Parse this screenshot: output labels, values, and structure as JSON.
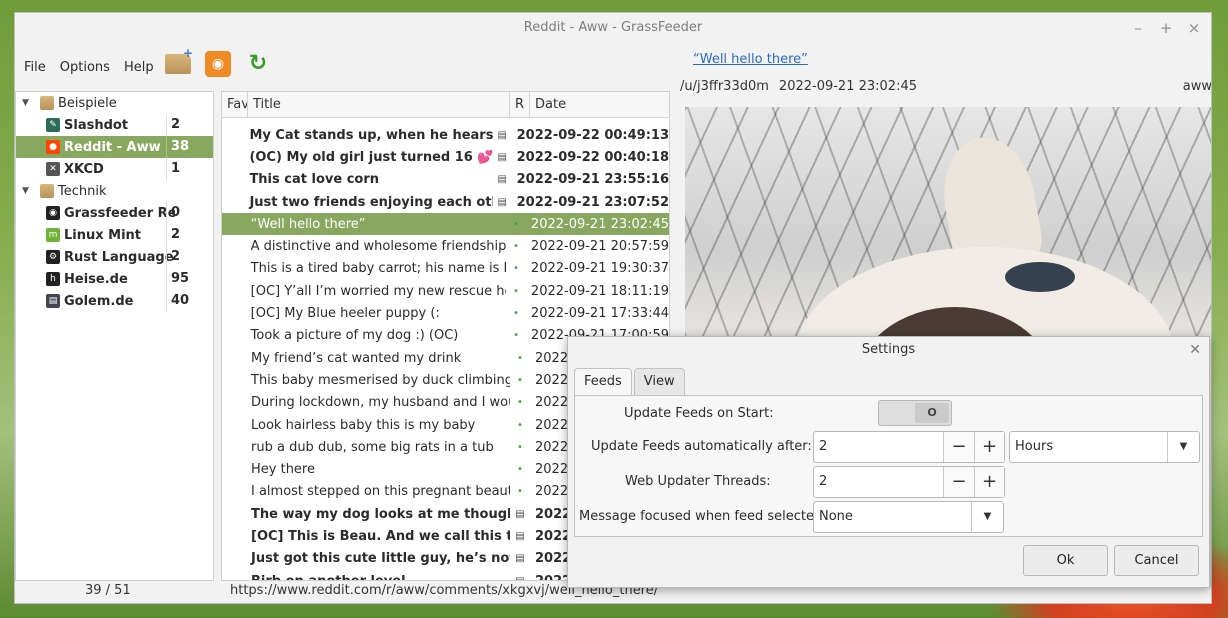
{
  "window": {
    "title": "Reddit - Aww - GrassFeeder",
    "controls": [
      "–",
      "+",
      "×"
    ]
  },
  "menu": [
    "File",
    "Options",
    "Help"
  ],
  "toolbar": {
    "icons": [
      "add-folder-icon",
      "add-feed-icon",
      "refresh-icon"
    ]
  },
  "header": {
    "item_title": "“Well hello there”",
    "author": "/u/j3ffr33d0m",
    "date": "2022-09-21 23:02:45",
    "category": "aww"
  },
  "tree": [
    {
      "label": "Beispiele",
      "count": "",
      "group": true
    },
    {
      "label": "Slashdot",
      "count": "2"
    },
    {
      "label": "Reddit - Aww",
      "count": "38",
      "selected": true
    },
    {
      "label": "XKCD",
      "count": "1"
    },
    {
      "label": "Technik",
      "count": "",
      "group": true
    },
    {
      "label": "Grassfeeder Rel",
      "count": "0"
    },
    {
      "label": "Linux Mint",
      "count": "2"
    },
    {
      "label": "Rust Language",
      "count": "2"
    },
    {
      "label": "Heise.de",
      "count": "95"
    },
    {
      "label": "Golem.de",
      "count": "40"
    }
  ],
  "list": {
    "columns": {
      "fav": "Fav",
      "title": "Title",
      "r": "R",
      "date": "Date"
    },
    "rows": [
      {
        "title": "My Cat stands up, when he hears bell nois",
        "date": "2022-09-22 00:49:13",
        "unread": true
      },
      {
        "title": "(OC) My old girl just turned 16 💕",
        "date": "2022-09-22 00:40:18",
        "unread": true
      },
      {
        "title": "This cat love corn",
        "date": "2022-09-21 23:55:16",
        "unread": true
      },
      {
        "title": "Just two friends enjoying each others co",
        "date": "2022-09-21 23:07:52",
        "unread": true
      },
      {
        "title": "“Well hello there”",
        "date": "2022-09-21 23:02:45",
        "unread": false,
        "selected": true
      },
      {
        "title": "A distinctive and wholesome friendship",
        "date": "2022-09-21 20:57:59",
        "unread": false
      },
      {
        "title": "This is a tired baby carrot; his name is Mr. M",
        "date": "2022-09-21 19:30:37",
        "unread": false
      },
      {
        "title": "[OC] Y’all I’m worried my new rescue hound",
        "date": "2022-09-21 18:11:19",
        "unread": false
      },
      {
        "title": "[OC] My Blue heeler puppy (:",
        "date": "2022-09-21 17:33:44",
        "unread": false
      },
      {
        "title": "Took a picture of my dog :) (OC)",
        "date": "2022-09-21 17:00:59",
        "unread": false
      },
      {
        "title": "My friend’s cat wanted my drink",
        "date": "2022-",
        "unread": false
      },
      {
        "title": "This baby mesmerised by duck climbing toy",
        "date": "2022-",
        "unread": false
      },
      {
        "title": "During lockdown, my husband and I would",
        "date": "2022-",
        "unread": false
      },
      {
        "title": "Look hairless baby this is my baby",
        "date": "2022-",
        "unread": false
      },
      {
        "title": "rub a dub dub, some big rats in a tub",
        "date": "2022-",
        "unread": false
      },
      {
        "title": "Hey there",
        "date": "2022-",
        "unread": false
      },
      {
        "title": "I almost stepped on this pregnant beauty w",
        "date": "2022-",
        "unread": false
      },
      {
        "title": "The way my dog looks at me though 🥹",
        "date": "2022-",
        "unread": true
      },
      {
        "title": "[OC] This is Beau. And we call this the “Be",
        "date": "2022-",
        "unread": true
      },
      {
        "title": "Just got this cute little guy, he’s not goin",
        "date": "2022-",
        "unread": true
      },
      {
        "title": "Birb on another level",
        "date": "2022-",
        "unread": true
      }
    ]
  },
  "status": {
    "counts": "39  /     51",
    "url": "https://www.reddit.com/r/aww/comments/xkgxvj/well_hello_there/"
  },
  "settings": {
    "title": "Settings",
    "tabs": [
      "Feeds",
      "View"
    ],
    "update_on_start_label": "Update Feeds on Start:",
    "toggle_state": "O",
    "auto_update_label": "Update Feeds automatically after:",
    "auto_update_value": "2",
    "auto_update_unit": "Hours",
    "threads_label": "Web Updater Threads:",
    "threads_value": "2",
    "focus_label": "Message focused when feed selected:",
    "focus_value": "None",
    "minus": "−",
    "plus": "+",
    "ok": "Ok",
    "cancel": "Cancel"
  },
  "colors": {
    "selection": "#88a860",
    "link": "#2a6ac9"
  }
}
